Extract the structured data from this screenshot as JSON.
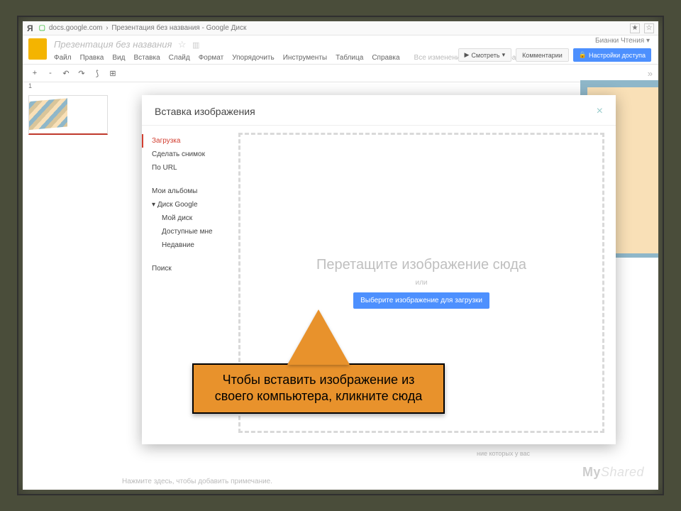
{
  "browser": {
    "yandex": "Я",
    "domain": "docs.google.com",
    "page_title": "Презентация без названия - Google Диск",
    "star_icon": "☆",
    "lock_icon": "●"
  },
  "header": {
    "doc_name": "Презентация без названия",
    "user": "Бианки Чтения ▾",
    "menu": {
      "file": "Файл",
      "edit": "Правка",
      "view": "Вид",
      "insert": "Вставка",
      "slide": "Слайд",
      "format": "Формат",
      "arrange": "Упорядочить",
      "tools": "Инструменты",
      "table": "Таблица",
      "help": "Справка",
      "saved": "Все изменения на Диске сохранены"
    },
    "buttons": {
      "view": "Смотреть",
      "comments": "Комментарии",
      "share": "Настройки доступа"
    }
  },
  "toolbar": {
    "plus": "+",
    "minus": "-",
    "undo": "↶",
    "redo": "↷",
    "paint": "⟆",
    "collapse": "»"
  },
  "thumbs": {
    "n1": "1"
  },
  "modal": {
    "title": "Вставка изображения",
    "close": "×",
    "side": {
      "upload": "Загрузка",
      "snapshot": "Сделать снимок",
      "byurl": "По URL",
      "albums": "Мои альбомы",
      "gdrive": "Диск Google",
      "mydrive": "Мой диск",
      "shared": "Доступные мне",
      "recent": "Недавние",
      "search": "Поиск"
    },
    "drop": {
      "text": "Перетащите изображение сюда",
      "or": "или",
      "button": "Выберите изображение для загрузки"
    }
  },
  "notes": {
    "placeholder": "Нажмите здесь, чтобы добавить примечание.",
    "hint": "ние которых у вас"
  },
  "callout": {
    "text": "Чтобы вставить изображение из своего компьютера, кликните сюда"
  },
  "watermark": {
    "a": "My",
    "b": "Shared"
  }
}
